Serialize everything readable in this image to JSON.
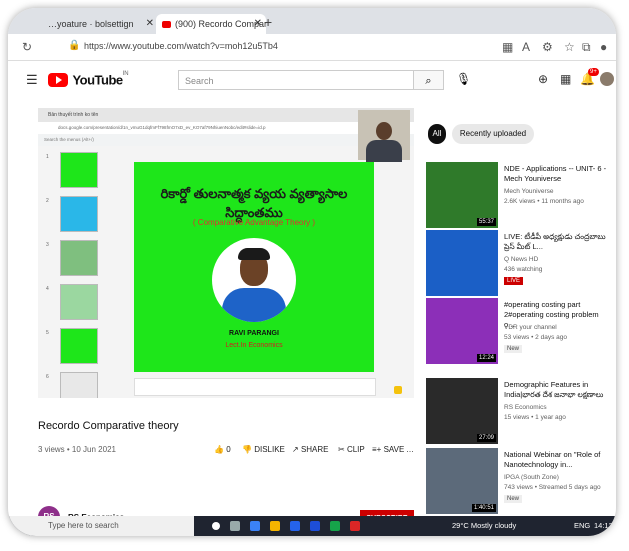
{
  "browser": {
    "tabs": [
      {
        "label": "…yoature · bolsettign"
      },
      {
        "label": "(900) Recordo Comparati"
      }
    ],
    "url": "https://www.youtube.com/watch?v=moh12u5Tb4"
  },
  "youtube": {
    "logo_text": "YouTube",
    "logo_suffix": "IN",
    "search_placeholder": "Search",
    "notification_count": "9+"
  },
  "video": {
    "inner_tab": "Bản thuyết trình ko tên",
    "inner_url": "docs.google.com/presentation/d/1n_vmuG1dqfmFf798fmO7xD_ev_KO7af79NhiuenNobc/edit#slide=id.p",
    "inner_toolbar": "Search the menus (Alt+/)",
    "slide_title": "రికార్డో తులనాత్మక వ్యయ వ్యత్యాసాల సిద్ధాంతము",
    "slide_subtitle": "( Comparative Advantage Theory )",
    "presenter_name": "RAVI PARANGI",
    "presenter_role": "Lect.In Economics",
    "title": "Recordo Comparative theory",
    "meta": "3 views • 10 Jun 2021",
    "actions": {
      "like": "0",
      "dislike": "DISLIKE",
      "share": "SHARE",
      "clip": "CLIP",
      "save": "SAVE",
      "more": "…"
    },
    "channel_name": "RS Economics",
    "channel_initials": "RS",
    "subscribe": "SUBSCRIBE"
  },
  "chips": {
    "all": "All",
    "recent": "Recently uploaded"
  },
  "related": [
    {
      "title": "NDE - Applications -- UNIT- 6 - Mech Youniverse",
      "channel": "Mech Youniverse",
      "views": "2.6K views • 11 months ago",
      "duration": "55:37",
      "badge": "",
      "thumb_color": "#2f7a2a"
    },
    {
      "title": "LIVE: టీడీపీ అధ్యక్షుడు చంద్రబాబు ప్రెస్ మీట్ L...",
      "channel": "Q News HD",
      "views": "436 watching",
      "duration": "",
      "badge": "LIVE",
      "thumb_color": "#1b5fc6"
    },
    {
      "title": "#operating costing part 2#operating costing problem o...",
      "channel": "VDR your channel",
      "views": "53 views • 2 days ago",
      "duration": "12:24",
      "badge": "New",
      "thumb_color": "#8c2fb8"
    },
    {
      "title": "Demographic Features in India|భారత దేశ జనాభా లక్షణాలు",
      "channel": "RS Economics",
      "views": "15 views • 1 year ago",
      "duration": "27:09",
      "badge": "",
      "thumb_color": "#2a2a2a"
    },
    {
      "title": "National Webinar on \"Role of Nanotechnology in...",
      "channel": "IPGA (South Zone)",
      "views": "743 views • Streamed 5 days ago",
      "duration": "1:40:51",
      "badge": "New",
      "thumb_color": "#5c6a7a"
    }
  ],
  "taskbar": {
    "search": "Type here to search",
    "weather": "29°C  Mostly cloudy",
    "lang": "ENG",
    "clock": "14:12"
  }
}
